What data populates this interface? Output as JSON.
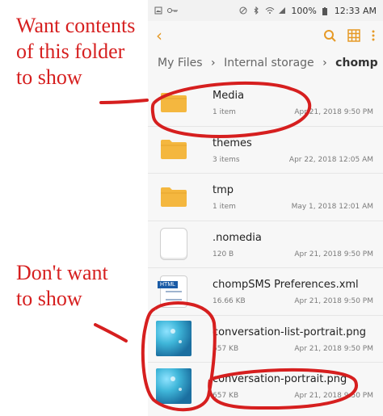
{
  "annotations": {
    "want": [
      "Want contents",
      "of this folder",
      "to show"
    ],
    "dont": [
      "Don't want",
      "to show"
    ]
  },
  "status": {
    "battery": "100%",
    "time": "12:33 AM"
  },
  "breadcrumb": {
    "root": "My Files",
    "storage": "Internal storage",
    "current": "chomp"
  },
  "files": [
    {
      "name": "Media",
      "meta": "1 item",
      "date": "Apr 21, 2018 9:50 PM",
      "kind": "folder"
    },
    {
      "name": "themes",
      "meta": "3 items",
      "date": "Apr 22, 2018 12:05 AM",
      "kind": "folder"
    },
    {
      "name": "tmp",
      "meta": "1 item",
      "date": "May 1, 2018 12:01 AM",
      "kind": "folder"
    },
    {
      "name": ".nomedia",
      "meta": "120 B",
      "date": "Apr 21, 2018 9:50 PM",
      "kind": "blank"
    },
    {
      "name": "chompSMS Preferences.xml",
      "meta": "16.66 KB",
      "date": "Apr 21, 2018 9:50 PM",
      "kind": "html"
    },
    {
      "name": "conversation-list-portrait.png",
      "meta": "657 KB",
      "date": "Apr 21, 2018 9:50 PM",
      "kind": "png"
    },
    {
      "name": "conversation-portrait.png",
      "meta": "657 KB",
      "date": "Apr 21, 2018 9:50 PM",
      "kind": "png"
    }
  ],
  "html_badge": "HTML",
  "colors": {
    "accent": "#e69a27",
    "folder": "#f4b73f",
    "annotation": "#d61f1f"
  }
}
